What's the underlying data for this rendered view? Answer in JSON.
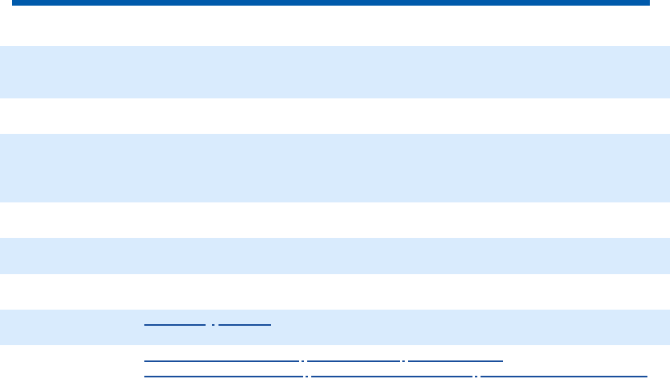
{
  "header": {
    "accent_color": "#005aab"
  },
  "table": {
    "shaded_color": "#d9ebfd",
    "rows": [
      {
        "label": "",
        "value": ""
      },
      {
        "label": "",
        "value": ""
      },
      {
        "label": "",
        "value": ""
      },
      {
        "label": "",
        "value": ""
      },
      {
        "label": "",
        "value": ""
      },
      {
        "label": "",
        "value": ""
      },
      {
        "label": "",
        "value": ""
      },
      {
        "label": "",
        "value": ""
      }
    ]
  },
  "links": {
    "row_a": [
      "",
      ""
    ],
    "row_b": [
      "",
      "",
      ""
    ],
    "row_c": [
      "",
      "",
      ""
    ]
  }
}
